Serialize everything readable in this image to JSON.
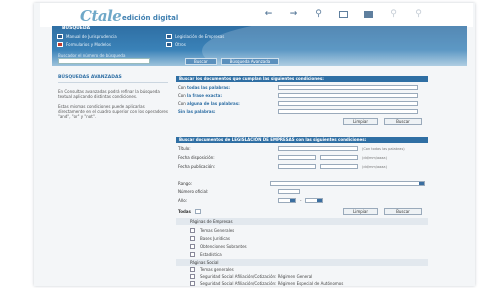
{
  "app": {
    "logo_mark": "Ctale",
    "logo_sub": "edición digital"
  },
  "toolbar": {
    "back": "←",
    "forward": "→",
    "search": "⚲",
    "print": "▭",
    "window": "▢",
    "zoom_out": "⚲",
    "zoom_in": "⚲"
  },
  "search_header": {
    "title": "BUSQUEDA",
    "categories": [
      {
        "label": "Manual de Jurisprudencia"
      },
      {
        "label": "Legislación de Empresas"
      },
      {
        "label": "Formularios y Modelos"
      },
      {
        "label": "Otros"
      }
    ],
    "buscar_numero": "Buscador el número de búsqueda",
    "tabs": [
      "Buscar",
      "Búsqueda Avanzada"
    ]
  },
  "left_panel": {
    "title": "BÚSQUEDAS AVANZADAS",
    "p1": "En Consultas avanzadas podrá refinar la búsqueda textual aplicando distintas condiciones.",
    "p2": "Estas mismas condiciones puede aplicarlas directamente en el cuadro superior con los operadores \"and\", \"or\" y \"not\"."
  },
  "box1": {
    "header": "Buscar los documentos que cumplan las siguientes condiciones:",
    "rows": [
      {
        "pre": "Con ",
        "bold": "todas las palabras:"
      },
      {
        "pre": "Con ",
        "bold": "la frase exacta:"
      },
      {
        "pre": "Con ",
        "bold": "alguna de las palabras:"
      },
      {
        "pre": "",
        "bold": "Sin las palabras:"
      }
    ],
    "limpiar": "Limpiar",
    "buscar": "Buscar"
  },
  "box2": {
    "header": "Buscar documentos de LEGISLACIÓN DE EMPRESAS con las siguientes condiciones:",
    "titulo": "Título:",
    "titulo_note": "(Con todas las palabras)",
    "fecha_disp": "Fecha disposición:",
    "fecha_pub": "Fecha publicación:",
    "date_note": "(dd/mm/aaaa)",
    "rango": "Rango:",
    "numero": "Número oficial:",
    "anio": "Año:",
    "todas": "Todas",
    "limpiar": "Limpiar",
    "buscar": "Buscar"
  },
  "sections": [
    {
      "title": "Páginas de Empresas",
      "items": [
        "Temas Generales",
        "Bases Jurídicas",
        "Obtenciones Sobrantes",
        "Estadística"
      ]
    },
    {
      "title": "Páginas Social",
      "items": [
        "Temas generales",
        "Seguridad Social Afiliación/Cotización: Régimen General",
        "Seguridad Social Afiliación/Cotización: Régimen Especial de Autónomos"
      ]
    }
  ],
  "colors": {
    "brand_blue": "#2f6fa4",
    "header_gradient_top": "#2f6fa4",
    "logo": "#6fa8c8"
  }
}
